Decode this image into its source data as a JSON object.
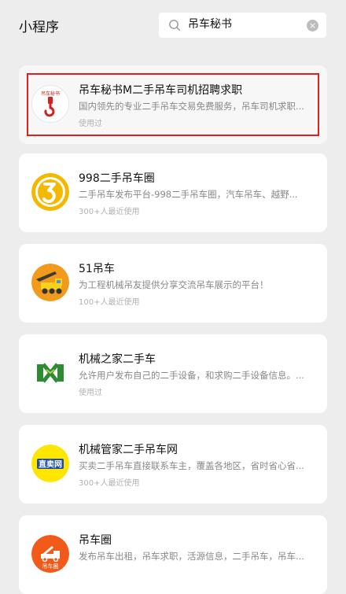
{
  "header": {
    "title": "小程序",
    "search_value": "吊车秘书",
    "clear_symbol": "×"
  },
  "colors": {
    "background": "#ededed",
    "card": "#ffffff",
    "highlight_border": "#e02020"
  },
  "results": [
    {
      "name": "吊车秘书M二手吊车司机招聘求职",
      "description": "国内领先的专业二手吊车交易免费服务，吊车司机求职...",
      "usage": "使用过",
      "icon": "crane-hook-icon",
      "icon_text": "吊车秘书",
      "highlighted": true
    },
    {
      "name": "998二手吊车圈",
      "description": "二手吊车发布平台-998二手吊车圈，汽车吊车、越野...",
      "usage": "300+人最近使用",
      "icon": "yellow-circle-logo-icon"
    },
    {
      "name": "51吊车",
      "description": "为工程机械吊友提供分享交流吊车展示的平台！",
      "usage": "100+人最近使用",
      "icon": "crane-truck-icon"
    },
    {
      "name": "机械之家二手车",
      "description": "允许用户发布自己的二手设备，和求购二手设备信息。...",
      "usage": "使用过",
      "icon": "green-x-logo-icon"
    },
    {
      "name": "机械管家二手吊车网",
      "description": "买卖二手吊车直接联系车主，覆盖各地区，省时省心省...",
      "usage": "300+人最近使用",
      "icon": "zhimai-logo-icon",
      "icon_text": "直卖网"
    },
    {
      "name": "吊车圈",
      "description": "发布吊车出租，吊车求职，活源信息，二手吊车，吊车...",
      "usage": "",
      "icon": "orange-tow-truck-icon",
      "icon_text": "吊车圈"
    }
  ]
}
